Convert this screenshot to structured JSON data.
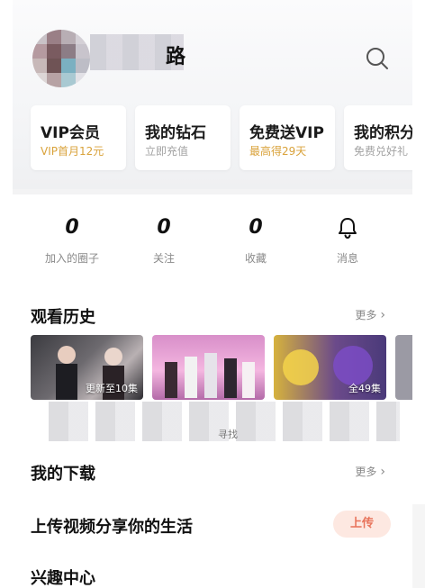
{
  "header": {
    "username_visible_suffix": "路",
    "search_icon": "search-icon"
  },
  "promo_cards": [
    {
      "title": "VIP会员",
      "subtitle": "VIP首月12元",
      "subtitle_color": "#d9a23a"
    },
    {
      "title": "我的钻石",
      "subtitle": "立即充值",
      "subtitle_color": "#a3a3a3"
    },
    {
      "title": "免费送VIP",
      "subtitle": "最高得29天",
      "subtitle_color": "#d9a23a"
    },
    {
      "title": "我的积分",
      "subtitle": "免费兑好礼",
      "subtitle_color": "#a3a3a3"
    }
  ],
  "stats": [
    {
      "value": "0",
      "label": "加入的圈子"
    },
    {
      "value": "0",
      "label": "关注"
    },
    {
      "value": "0",
      "label": "收藏"
    },
    {
      "value": "",
      "label": "消息",
      "icon": "bell-icon"
    }
  ],
  "history": {
    "title": "观看历史",
    "more": "更多",
    "items": [
      {
        "badge": "更新至10集"
      },
      {
        "badge": ""
      },
      {
        "badge": "全49集"
      }
    ],
    "blurred_caption": "寻找"
  },
  "downloads": {
    "title": "我的下载",
    "more": "更多"
  },
  "upload": {
    "title": "上传视频分享你的生活",
    "button": "上传"
  },
  "interest": {
    "title": "兴趣中心"
  },
  "colors": {
    "accent_gold": "#d9a23a",
    "upload_bg": "#fde8e1",
    "upload_fg": "#e8735a"
  }
}
